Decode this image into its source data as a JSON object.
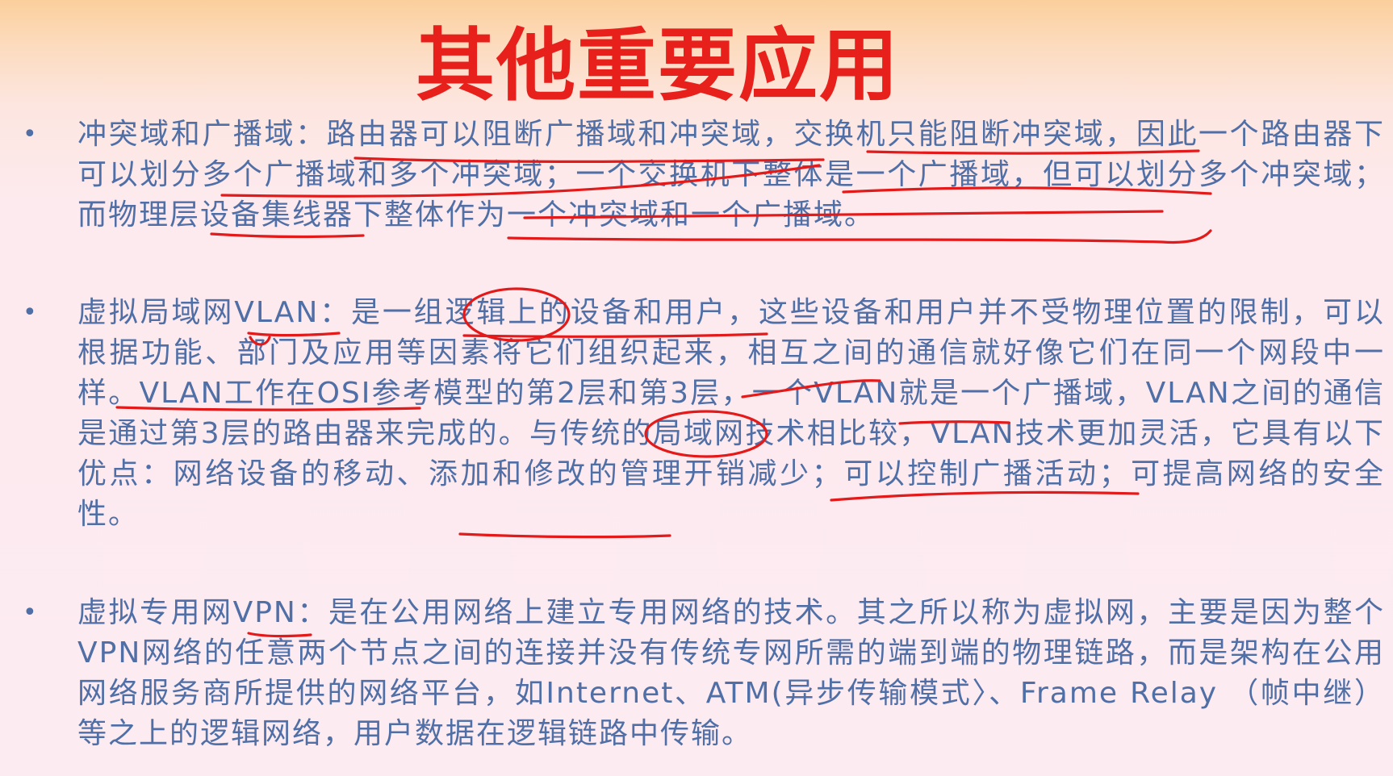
{
  "slide": {
    "title": "其他重要应用",
    "bullet_symbol": "•",
    "paragraphs": [
      "冲突域和广播域：路由器可以阻断广播域和冲突域，交换机只能阻断冲突域，因此一个路由器下可以划分多个广播域和多个冲突域；一个交换机下整体是一个广播域，但可以划分多个冲突域；而物理层设备集线器下整体作为一个冲突域和一个广播域。",
      "虚拟局域网VLAN：是一组逻辑上的设备和用户，这些设备和用户并不受物理位置的限制，可以根据功能、部门及应用等因素将它们组织起来，相互之间的通信就好像它们在同一个网段中一样。VLAN工作在OSI参考模型的第2层和第3层，一个VLAN就是一个广播域，VLAN之间的通信是通过第3层的路由器来完成的。与传统的局域网技术相比较，VLAN技术更加灵活，它具有以下优点：网络设备的移动、添加和修改的管理开销减少；可以控制广播活动；可提高网络的安全性。",
      "虚拟专用网VPN：是在公用网络上建立专用网络的技术。其之所以称为虚拟网，主要是因为整个VPN网络的任意两个节点之间的连接并没有传统专网所需的端到端的物理链路，而是架构在公用网络服务商所提供的网络平台，如Internet、ATM(异步传输模式〉、Frame Relay （帧中继）等之上的逻辑网络，用户数据在逻辑链路中传输。"
    ]
  },
  "colors": {
    "title": "#e8201c",
    "body_text": "#4f6fa6",
    "annotation_ink": "#e41a1a"
  }
}
